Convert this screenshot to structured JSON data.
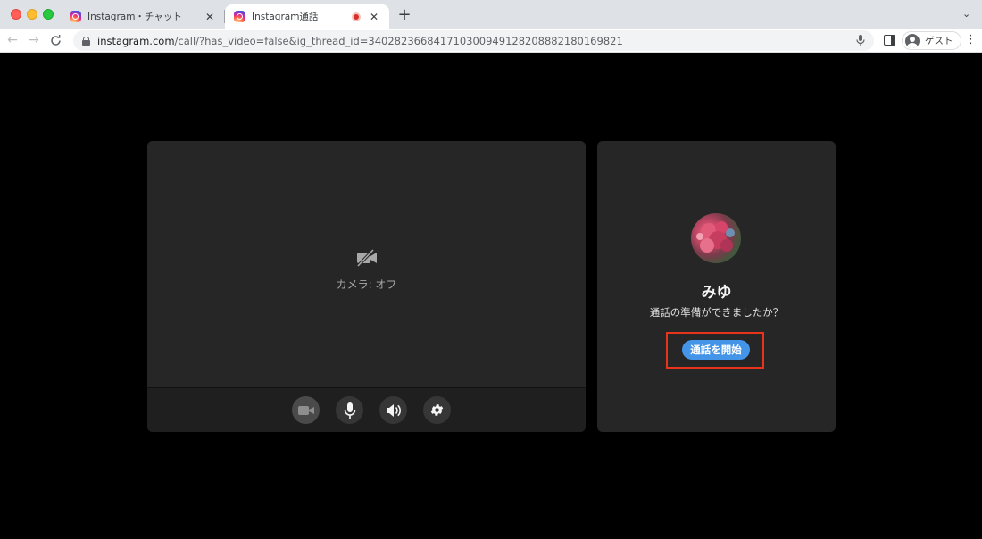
{
  "browser": {
    "tabs": [
      {
        "title": "Instagram・チャット",
        "active": false
      },
      {
        "title": "Instagram通話",
        "active": true,
        "recording": true
      }
    ],
    "url": {
      "host": "instagram.com",
      "path": "/call/?has_video=false&ig_thread_id=340282366841710300949128208882180169821"
    },
    "profile_label": "ゲスト"
  },
  "video": {
    "camera_status": "カメラ: オフ",
    "controls": [
      "video-camera-icon",
      "microphone-icon",
      "speaker-icon",
      "settings-gear-icon"
    ]
  },
  "call": {
    "callee_name": "みゆ",
    "prompt": "通話の準備ができましたか？",
    "start_button": "通話を開始"
  },
  "colors": {
    "accent": "#4494e8",
    "highlight": "#e8331d",
    "panel": "#262626",
    "background": "#000000"
  }
}
